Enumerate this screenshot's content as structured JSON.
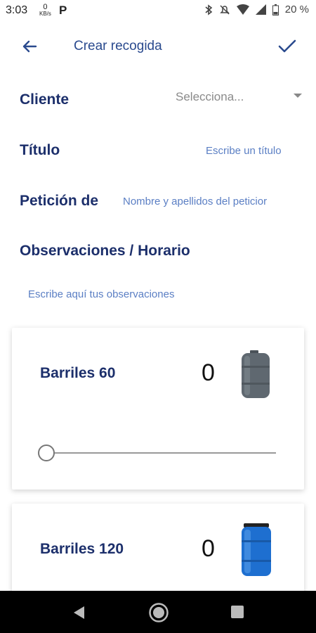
{
  "status": {
    "time": "3:03",
    "net_speed": "0",
    "net_unit": "KB/s",
    "p_badge": "P",
    "battery": "20 %"
  },
  "header": {
    "title": "Crear recogida",
    "back_icon": "arrow-back-icon",
    "confirm_icon": "check-icon"
  },
  "form": {
    "client_label": "Cliente",
    "client_value": "Selecciona...",
    "title_label": "Título",
    "title_placeholder": "Escribe un título",
    "request_label": "Petición de",
    "request_placeholder": "Nombre y apellidos del peticior",
    "observations_label": "Observaciones / Horario",
    "observations_placeholder": "Escribe aquí tus observaciones"
  },
  "items": [
    {
      "name": "Barriles 60",
      "count": "0",
      "color": "#5f6870",
      "slider": 0
    },
    {
      "name": "Barriles 120",
      "count": "0",
      "color": "#1e6fd0",
      "slider": 0
    }
  ],
  "colors": {
    "primary": "#1c2f6b",
    "accent": "#2a4a8e",
    "placeholder": "#5b7fc4"
  }
}
